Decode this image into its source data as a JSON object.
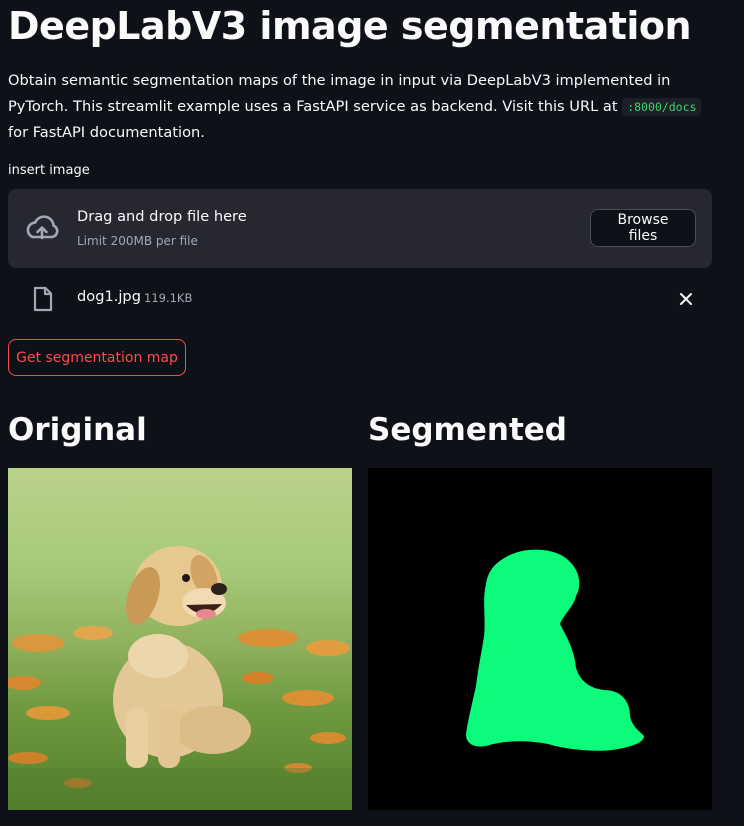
{
  "header": {
    "title": "DeepLabV3 image segmentation"
  },
  "description": {
    "part1": "Obtain semantic segmentation maps of the image in input via DeepLabV3 implemented in PyTorch. This streamlit example uses a FastAPI service as backend. Visit this URL at ",
    "code": ":8000/docs",
    "part2": " for FastAPI documentation."
  },
  "uploader": {
    "label": "insert image",
    "drag_text": "Drag and drop file here",
    "limit_text": "Limit 200MB per file",
    "browse_label": "Browse files",
    "icon": "cloud-upload-icon"
  },
  "file": {
    "name": "dog1.jpg",
    "size": "119.1KB",
    "icon": "file-icon"
  },
  "actions": {
    "segment_label": "Get segmentation map"
  },
  "columns": {
    "original_title": "Original",
    "segmented_title": "Segmented"
  },
  "colors": {
    "background": "#0e1117",
    "accent": "#ff4b4b",
    "mask": "#0dfb7a",
    "code_text": "#3dd56d"
  }
}
